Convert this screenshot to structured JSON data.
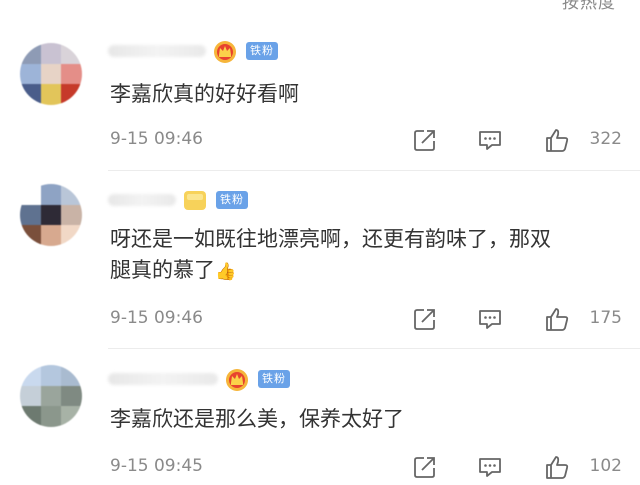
{
  "header": {
    "sort_label": "按热度"
  },
  "comments": [
    {
      "badge": "铁粉",
      "text": "李嘉欣真的好好看啊",
      "time": "9-15 09:46",
      "likes": "322",
      "vip_icon": "crown-icon",
      "avatar_colors": [
        "#8e9bb5",
        "#c9c2d2",
        "#d9d3d9",
        "#9db4d8",
        "#e7d3c6",
        "#e48e88",
        "#4a5d8a",
        "#e2c55a",
        "#c63a2a"
      ]
    },
    {
      "badge": "铁粉",
      "text_line1": "呀还是一如既往地漂亮啊，还更有韵味了，那双",
      "text_line2": "腿真的慕了",
      "time": "9-15 09:46",
      "likes": "175",
      "vip_icon": "yellow-badge-icon",
      "avatar_colors": [
        "#ffffff",
        "#8ea3c4",
        "#b9c6d8",
        "#5f7290",
        "#2e2a36",
        "#c9b3a6",
        "#7a4f3b",
        "#d7a98f",
        "#f1d8c6"
      ]
    },
    {
      "badge": "铁粉",
      "text": "李嘉欣还是那么美，保养太好了",
      "time": "9-15 09:45",
      "likes": "102",
      "vip_icon": "crown-icon",
      "avatar_colors": [
        "#c9d9ee",
        "#b4c7de",
        "#a9bbd0",
        "#c5cfd8",
        "#9aa59c",
        "#7f8a82",
        "#6d7a70",
        "#8b978c",
        "#a7b2a6"
      ]
    }
  ]
}
